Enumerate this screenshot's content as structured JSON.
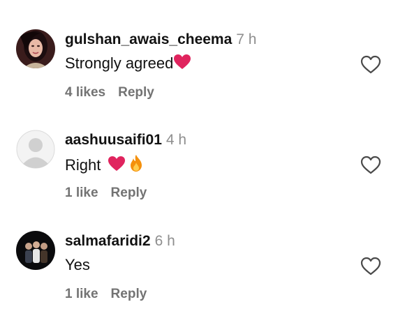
{
  "comments": [
    {
      "username": "gulshan_awais_cheema",
      "time": "7 h",
      "text": "Strongly agreed",
      "likes": "4 likes",
      "reply": "Reply",
      "emojis": [
        "red-heart"
      ]
    },
    {
      "username": "aashuusaifi01",
      "time": "4 h",
      "text": "Right",
      "likes": "1 like",
      "reply": "Reply",
      "emojis": [
        "red-heart",
        "fire"
      ]
    },
    {
      "username": "salmafaridi2",
      "time": "6 h",
      "text": "Yes",
      "likes": "1 like",
      "reply": "Reply",
      "emojis": []
    }
  ],
  "icons": {
    "like": "heart-outline-icon",
    "default_avatar": "default-avatar-icon"
  },
  "colors": {
    "username": "#121212",
    "secondary": "#8e8e8e",
    "actions": "#737373",
    "heart_emoji": "#e0245e",
    "heart_outline": "#4a4a4a"
  }
}
